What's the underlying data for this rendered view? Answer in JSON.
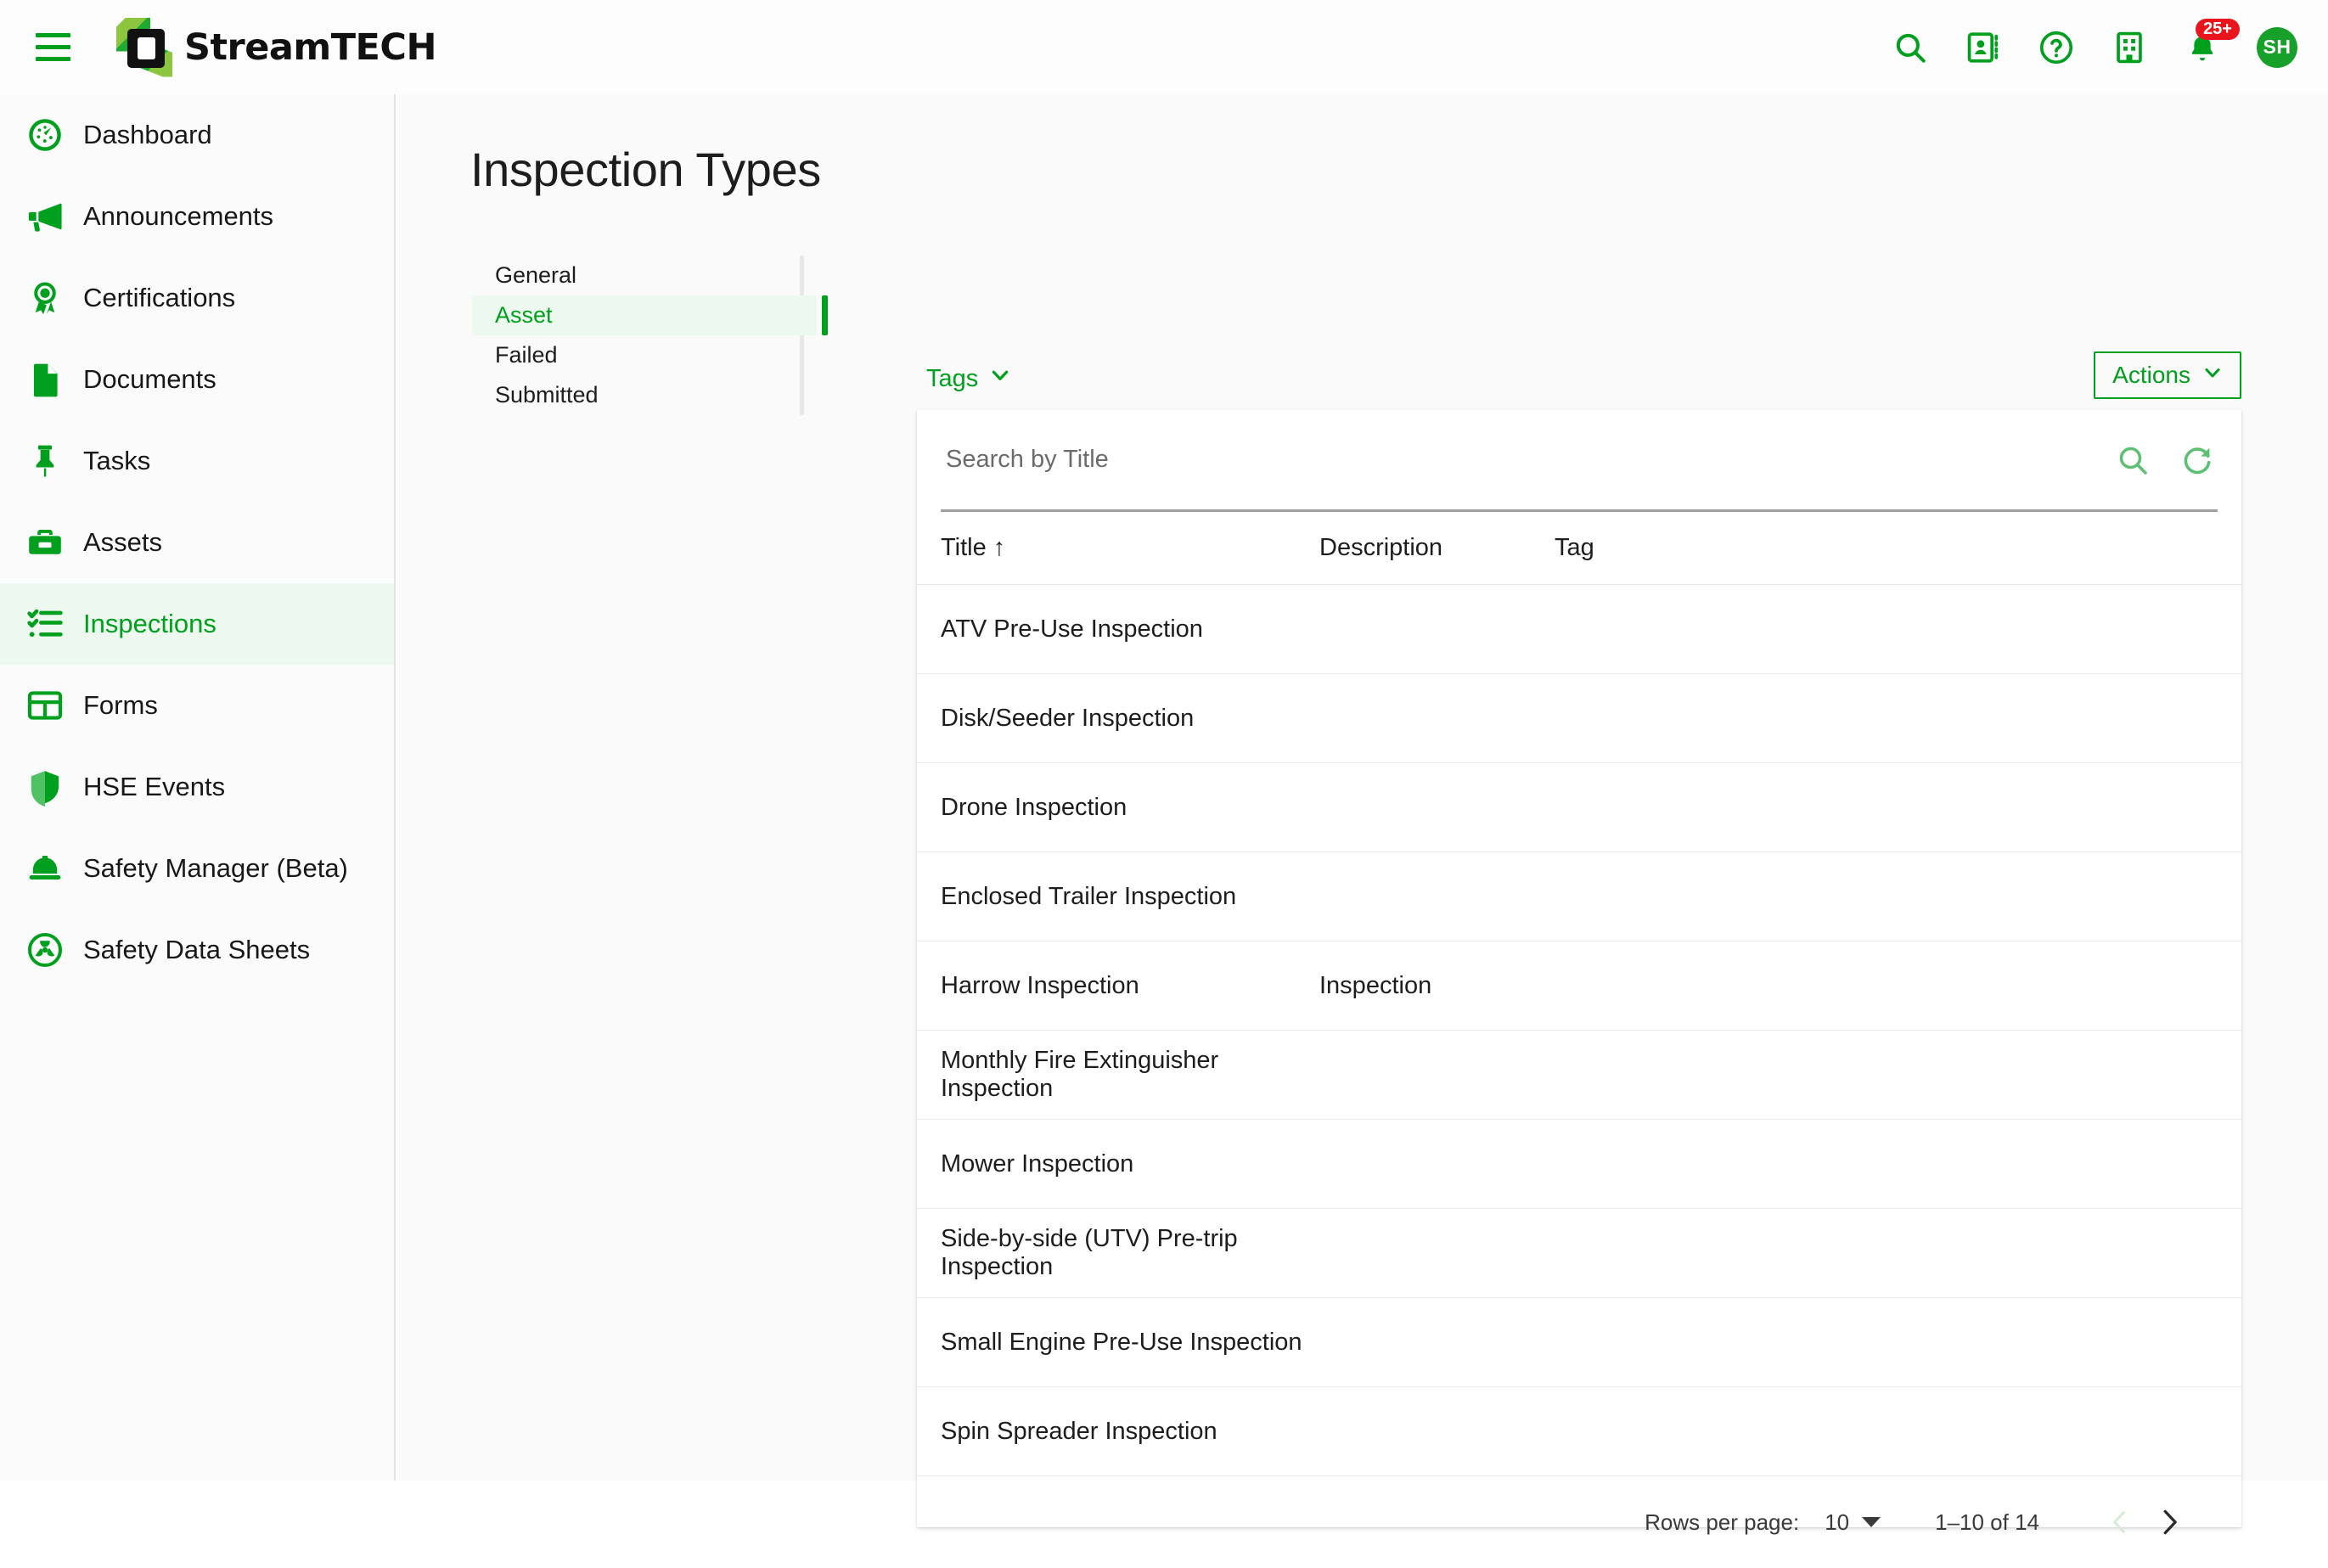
{
  "app": {
    "brand_name": "StreamTECH",
    "menu_icon": "hamburger-icon",
    "accent_color": "#00a01e",
    "badge_color": "#e8151d"
  },
  "topbar": {
    "icons": [
      {
        "name": "search-icon",
        "label": "Search"
      },
      {
        "name": "contact-card-icon",
        "label": "Contacts"
      },
      {
        "name": "help-icon",
        "label": "Help"
      },
      {
        "name": "company-building-icon",
        "label": "Company"
      },
      {
        "name": "notifications-bell-icon",
        "label": "Notifications"
      }
    ],
    "notification_count": "25+",
    "avatar_initials": "SH"
  },
  "sidebar": {
    "items": [
      {
        "label": "Dashboard",
        "icon": "gauge-icon",
        "active": false
      },
      {
        "label": "Announcements",
        "icon": "megaphone-icon",
        "active": false
      },
      {
        "label": "Certifications",
        "icon": "award-ribbon-icon",
        "active": false
      },
      {
        "label": "Documents",
        "icon": "document-icon",
        "active": false
      },
      {
        "label": "Tasks",
        "icon": "pushpin-icon",
        "active": false
      },
      {
        "label": "Assets",
        "icon": "toolbox-icon",
        "active": false
      },
      {
        "label": "Inspections",
        "icon": "checklist-icon",
        "active": true
      },
      {
        "label": "Forms",
        "icon": "table-grid-icon",
        "active": false
      },
      {
        "label": "HSE Events",
        "icon": "shield-icon",
        "active": false
      },
      {
        "label": "Safety Manager (Beta)",
        "icon": "hardhat-icon",
        "active": false
      },
      {
        "label": "Safety Data Sheets",
        "icon": "hazard-icon",
        "active": false
      }
    ]
  },
  "main": {
    "page_title": "Inspection Types",
    "tabs": [
      {
        "label": "General",
        "active": false
      },
      {
        "label": "Asset",
        "active": true
      },
      {
        "label": "Failed",
        "active": false
      },
      {
        "label": "Submitted",
        "active": false
      }
    ],
    "toolbar": {
      "tags_label": "Tags",
      "actions_label": "Actions"
    },
    "search": {
      "placeholder": "Search by Title",
      "value": "",
      "search_icon": "search-icon",
      "refresh_icon": "refresh-icon"
    },
    "table": {
      "columns": [
        "Title",
        "Description",
        "Tag"
      ],
      "sort_column": "Title",
      "sort_direction": "↑",
      "rows": [
        {
          "title": "ATV Pre-Use Inspection",
          "description": "",
          "tag": ""
        },
        {
          "title": "Disk/Seeder Inspection",
          "description": "",
          "tag": ""
        },
        {
          "title": "Drone Inspection",
          "description": "",
          "tag": ""
        },
        {
          "title": "Enclosed Trailer Inspection",
          "description": "",
          "tag": ""
        },
        {
          "title": "Harrow Inspection",
          "description": "Inspection",
          "tag": ""
        },
        {
          "title": "Monthly Fire Extinguisher Inspection",
          "description": "",
          "tag": ""
        },
        {
          "title": "Mower Inspection",
          "description": "",
          "tag": ""
        },
        {
          "title": "Side-by-side (UTV) Pre-trip Inspection",
          "description": "",
          "tag": ""
        },
        {
          "title": "Small Engine Pre-Use Inspection",
          "description": "",
          "tag": ""
        },
        {
          "title": "Spin Spreader Inspection",
          "description": "",
          "tag": ""
        }
      ]
    },
    "pagination": {
      "rows_per_page_label": "Rows per page:",
      "rows_per_page_value": "10",
      "range_label": "1–10 of 14",
      "prev_icon": "chevron-left-icon",
      "next_icon": "chevron-right-icon",
      "prev_disabled": true
    }
  }
}
